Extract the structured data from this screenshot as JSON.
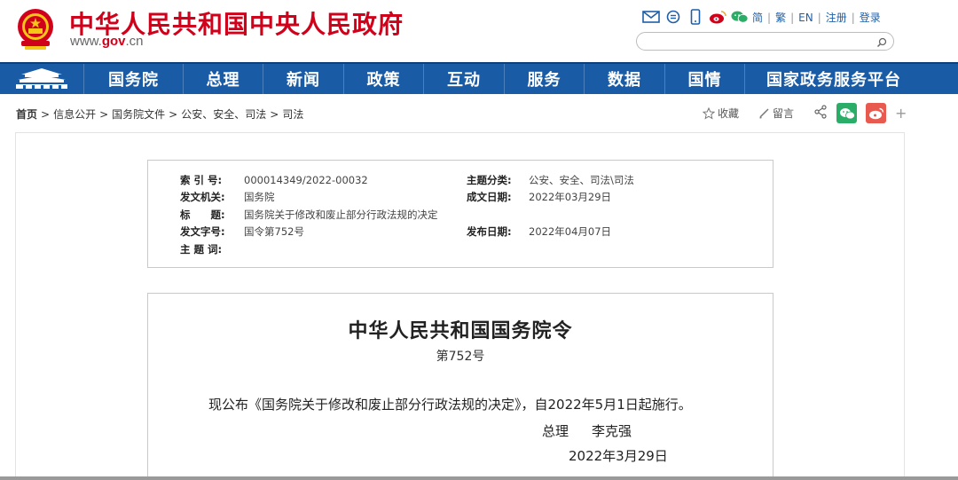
{
  "header": {
    "site_title": "中华人民共和国中央人民政府",
    "domain_prefix": "www.",
    "domain_main": "gov",
    "domain_suffix": ".cn",
    "top_icons": [
      "mail-icon",
      "message-icon",
      "mobile-icon",
      "weibo-icon",
      "wechat-icon"
    ],
    "lang_links": [
      "简",
      "繁",
      "EN",
      "注册",
      "登录"
    ],
    "search": {
      "placeholder": "",
      "value": ""
    }
  },
  "nav": {
    "items": [
      "国务院",
      "总理",
      "新闻",
      "政策",
      "互动",
      "服务",
      "数据",
      "国情",
      "国家政务服务平台"
    ]
  },
  "breadcrumb": {
    "items": [
      "首页",
      "信息公开",
      "国务院文件",
      "公安、安全、司法",
      "司法"
    ]
  },
  "actions": {
    "favorite": "收藏",
    "comment": "留言"
  },
  "meta": {
    "index_label": "索 引 号:",
    "index_value": "000014349/2022-00032",
    "issuer_label": "发文机关:",
    "issuer_value": "国务院",
    "title_label": "标　　题:",
    "title_value": "国务院关于修改和废止部分行政法规的决定",
    "docno_label": "发文字号:",
    "docno_value": "国令第752号",
    "keywords_label": "主 题 词:",
    "keywords_value": "",
    "category_label": "主题分类:",
    "category_value": "公安、安全、司法\\司法",
    "written_label": "成文日期:",
    "written_value": "2022年03月29日",
    "published_label": "发布日期:",
    "published_value": "2022年04月07日"
  },
  "doc": {
    "title": "中华人民共和国国务院令",
    "number": "第752号",
    "body": "现公布《国务院关于修改和废止部分行政法规的决定》，自2022年5月1日起施行。",
    "sign_role": "总理",
    "sign_name": "李克强",
    "date": "2022年3月29日"
  },
  "colors": {
    "brand_red": "#d0021b",
    "nav_blue": "#1a5ba6",
    "link_blue": "#1f5fa8",
    "wechat_green": "#2aae67",
    "weibo_red": "#e8594f"
  }
}
